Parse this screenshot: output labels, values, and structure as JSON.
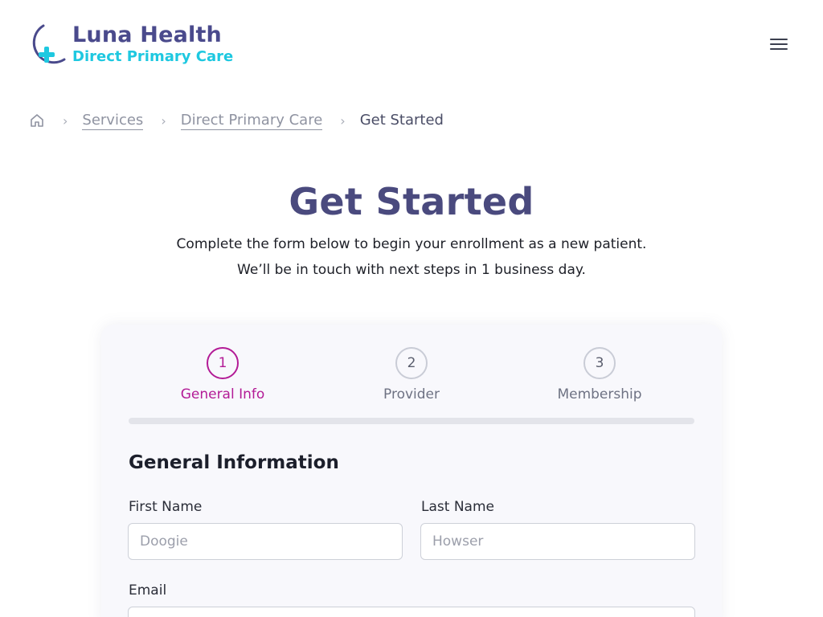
{
  "brand": {
    "name": "Luna Health",
    "tagline": "Direct Primary Care",
    "colors": {
      "primary": "#4a4a8c",
      "accent": "#1ec8e0",
      "active_step": "#b31b96"
    }
  },
  "header": {
    "menu_icon": "hamburger-icon"
  },
  "breadcrumb": {
    "home_icon": "home-icon",
    "items": [
      {
        "label": "Services"
      },
      {
        "label": "Direct Primary Care"
      }
    ],
    "current": "Get Started"
  },
  "hero": {
    "title": "Get Started",
    "lead_line1": "Complete the form below to begin your enrollment as a new patient.",
    "lead_line2": "We’ll be in touch with next steps in 1 business day."
  },
  "steps": [
    {
      "number": "1",
      "label": "General Info",
      "active": true
    },
    {
      "number": "2",
      "label": "Provider",
      "active": false
    },
    {
      "number": "3",
      "label": "Membership",
      "active": false
    }
  ],
  "form": {
    "section_title": "General Information",
    "first_name": {
      "label": "First Name",
      "placeholder": "Doogie",
      "value": ""
    },
    "last_name": {
      "label": "Last Name",
      "placeholder": "Howser",
      "value": ""
    },
    "email": {
      "label": "Email",
      "placeholder": "",
      "value": ""
    }
  }
}
